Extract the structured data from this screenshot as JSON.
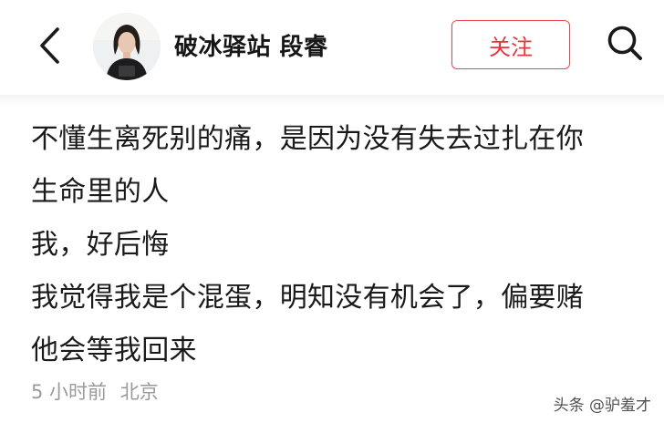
{
  "header": {
    "back_icon": "chevron-left-icon",
    "author_name": "破冰驿站 段睿",
    "follow_label": "关注",
    "search_icon": "search-icon",
    "accent_color": "#e6343b"
  },
  "post": {
    "lines": [
      "不懂生离死别的痛，是因为没有失去过扎在你",
      "生命里的人",
      "我，好后悔",
      "我觉得我是个混蛋，明知没有机会了，偏要赌",
      "他会等我回来"
    ],
    "time": "5 小时前",
    "location": "北京"
  },
  "watermark": "头条 @驴羞才"
}
